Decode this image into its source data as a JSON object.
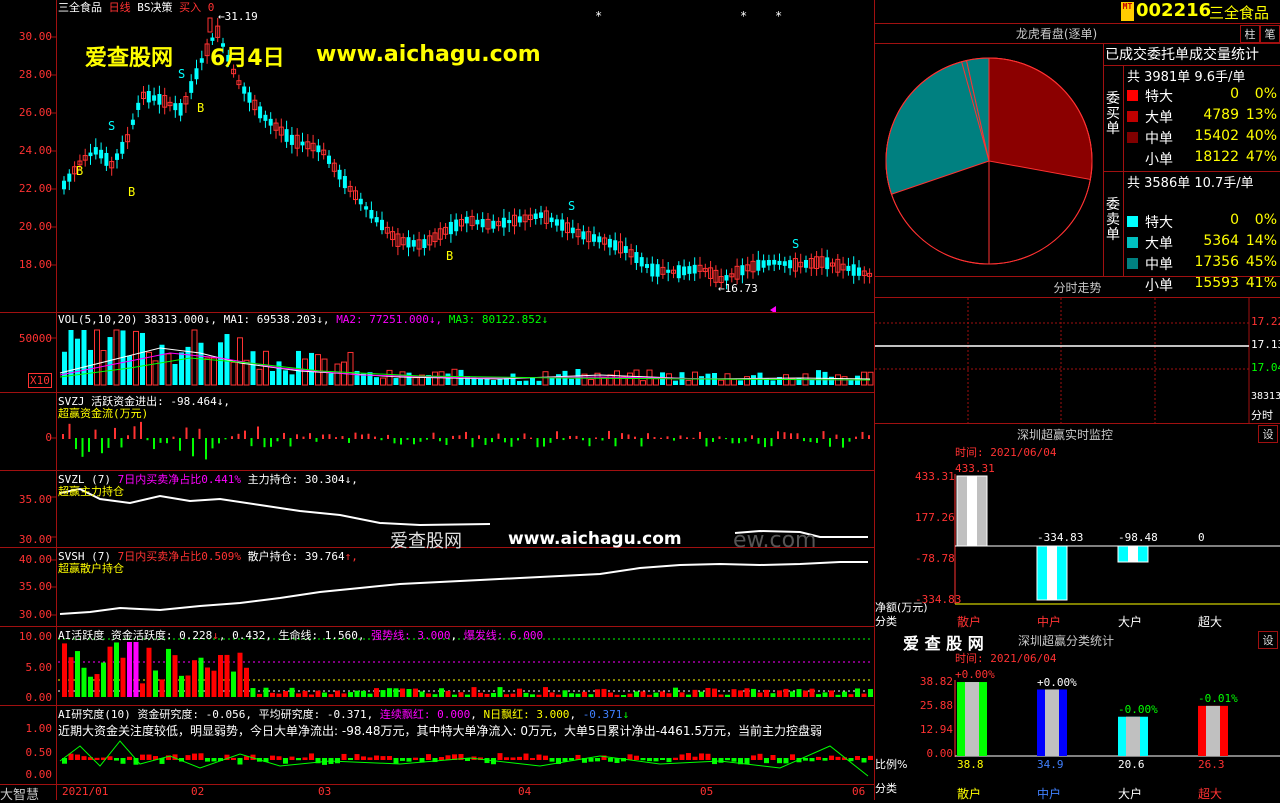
{
  "main_chart": {
    "stock_name": "三全食品",
    "period": "日线",
    "indicator": "BS决策",
    "signal": "买入",
    "signal_value": "0",
    "high_mark": "31.19",
    "low_mark": "16.73",
    "y_ticks": [
      "30.00",
      "28.00",
      "26.00",
      "24.00",
      "22.00",
      "20.00",
      "18.00"
    ],
    "watermark": {
      "site": "爱查股网",
      "date": "6月4日",
      "url": "www.aichagu.com"
    },
    "bs_labels": [
      "S",
      "B",
      "S",
      "B",
      "S",
      "B",
      "S",
      "B",
      "S"
    ]
  },
  "vol_panel": {
    "title": "VOL(5,10,20)",
    "vol_value": "38313.000",
    "ma1": "MA1: 69538.203",
    "ma2": "MA2: 77251.000",
    "ma3": "MA3: 80122.852",
    "y_tick": "50000",
    "unit": "X10"
  },
  "svzj_panel": {
    "title": "SVZJ",
    "desc": "活跃资金进出: -98.464",
    "subtitle": "超赢资金流(万元)",
    "y_tick": "0"
  },
  "svzl_panel": {
    "title": "SVZL (7)",
    "desc": "7日内买卖净占比0.441%",
    "holding": "主力持仓: 30.304",
    "subtitle": "超赢主力持仓",
    "y_ticks": [
      "35.00",
      "30.00"
    ]
  },
  "svsh_panel": {
    "title": "SVSH (7)",
    "desc": "7日内买卖净占比0.509%",
    "holding": "散户持仓: 39.764",
    "subtitle": "超赢散户持仓",
    "y_ticks": [
      "40.00",
      "35.00",
      "30.00"
    ]
  },
  "overlay_watermark": {
    "site": "爱查股网",
    "url": "www.aichagu.com",
    "ghost": "ew.com"
  },
  "ai_active_panel": {
    "title": "AI活跃度",
    "fund": "资金活跃度: 0.228",
    "v2": "0.432",
    "life": "生命线: 1.560",
    "strong": "强势线: 3.000",
    "burst": "爆发线: 6.000",
    "y_ticks": [
      "10.00",
      "5.00",
      "0.00"
    ]
  },
  "ai_research_panel": {
    "title": "AI研究度(10)",
    "fund": "资金研究度: -0.056",
    "avg": "平均研究度: -0.371",
    "red_days": "连续飘红: 0.000",
    "n_days": "N日飘红: 3.000",
    "v3": "-0.371",
    "comment": "近期大资金关注度较低，明显弱势，今日大单净流出: -98.48万元，其中特大单净流入: 0万元，大单5日累计净出-4461.5万元，当前主力控盘弱",
    "y_ticks": [
      "1.00",
      "0.50",
      "0.00"
    ]
  },
  "time_axis": {
    "app": "大智慧",
    "labels": [
      "2021/01",
      "02",
      "03",
      "04",
      "05",
      "06"
    ]
  },
  "header": {
    "code": "002216",
    "name": "三全食品",
    "badge": "MT",
    "btn1": "柱",
    "btn2": "笔"
  },
  "order_stats": {
    "panel_title": "龙虎看盘(逐单)",
    "title": "已成交委托单成交量统计",
    "buy_side": "委买单",
    "sell_side": "委卖单",
    "buy_total": "共 3981单 9.6手/单",
    "sell_total": "共 3586单 10.7手/单",
    "buy_rows": [
      {
        "label": "特大",
        "value": "0",
        "pct": "0%",
        "color": "#ff0000"
      },
      {
        "label": "大单",
        "value": "4789",
        "pct": "13%",
        "color": "#c00000"
      },
      {
        "label": "中单",
        "value": "15402",
        "pct": "40%",
        "color": "#800000"
      },
      {
        "label": "小单",
        "value": "18122",
        "pct": "47%",
        "color": "#000000"
      }
    ],
    "sell_rows": [
      {
        "label": "特大",
        "value": "0",
        "pct": "0%",
        "color": "#00ffff"
      },
      {
        "label": "大单",
        "value": "5364",
        "pct": "14%",
        "color": "#00c0c0"
      },
      {
        "label": "中单",
        "value": "17356",
        "pct": "45%",
        "color": "#008080"
      },
      {
        "label": "小单",
        "value": "15593",
        "pct": "41%",
        "color": "#000000"
      }
    ]
  },
  "intraday": {
    "title": "分时走势",
    "ticks": [
      "17.22",
      "17.13",
      "17.04"
    ],
    "vol": "38313",
    "vol_label": "分时"
  },
  "monitor": {
    "title": "深圳超赢实时监控",
    "btn": "设",
    "time": "时间: 2021/06/04",
    "y_ticks": [
      "433.31",
      "177.26",
      "-78.78",
      "-334.83"
    ],
    "top_value": "433.31",
    "bar_values": [
      "-334.83",
      "-98.48",
      "0"
    ],
    "ylabel": "净额(万元)",
    "xlabel": "分类",
    "categories": [
      "散户",
      "中户",
      "大户",
      "超大"
    ]
  },
  "class_stats": {
    "logo": "爱 查 股 网",
    "title": "深圳超赢分类统计",
    "btn": "设",
    "time": "时间: 2021/06/04",
    "y_ticks": [
      "38.82",
      "25.88",
      "12.94",
      "0.00"
    ],
    "changes": [
      "+0.00%",
      "+0.00%",
      "-0.00%",
      "-0.01%"
    ],
    "values": [
      "38.8",
      "34.9",
      "20.6",
      "26.3"
    ],
    "ylabel": "比例%",
    "xlabel": "分类",
    "categories": [
      "散户",
      "中户",
      "大户",
      "超大"
    ]
  },
  "chart_data": [
    {
      "type": "pie",
      "title": "已成交委托单成交量统计",
      "labels": [
        "委买单 大单",
        "委买单 中单",
        "委买单 小单",
        "委卖单 大单",
        "委卖单 中单",
        "委卖单 小单"
      ],
      "values": [
        4789,
        15402,
        18122,
        5364,
        17356,
        15593
      ],
      "colors": [
        "#8b0000",
        "#8b0000",
        "#000000",
        "#008080",
        "#008080",
        "#000000"
      ]
    },
    {
      "type": "bar",
      "title": "深圳超赢实时监控",
      "categories": [
        "散户",
        "中户",
        "大户",
        "超大"
      ],
      "values": [
        433.31,
        -334.83,
        -98.48,
        0
      ],
      "ylim": [
        -334.83,
        433.31
      ]
    },
    {
      "type": "bar",
      "title": "深圳超赢分类统计",
      "categories": [
        "散户",
        "中户",
        "大户",
        "超大"
      ],
      "values": [
        38.8,
        34.9,
        20.6,
        26.3
      ],
      "ylim": [
        0,
        38.82
      ]
    }
  ]
}
